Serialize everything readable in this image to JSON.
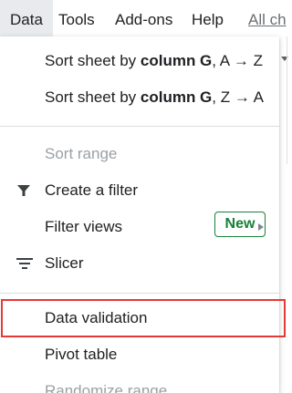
{
  "menubar": {
    "items": [
      "Data",
      "Tools",
      "Add-ons",
      "Help"
    ],
    "link": "All ch"
  },
  "menu": {
    "sort_az": {
      "prefix": "Sort sheet by ",
      "bold": "column G",
      "suffix": ", A → Z"
    },
    "sort_za": {
      "prefix": "Sort sheet by ",
      "bold": "column G",
      "suffix": ", Z → A"
    },
    "sort_range": "Sort range",
    "create_filter": "Create a filter",
    "filter_views": "Filter views",
    "slicer": "Slicer",
    "slicer_badge": "New",
    "data_validation": "Data validation",
    "pivot_table": "Pivot table",
    "randomize_range": "Randomize range"
  },
  "colors": {
    "highlight": "#e53935",
    "badge": "#188038",
    "disabled_text": "#9aa0a6"
  }
}
